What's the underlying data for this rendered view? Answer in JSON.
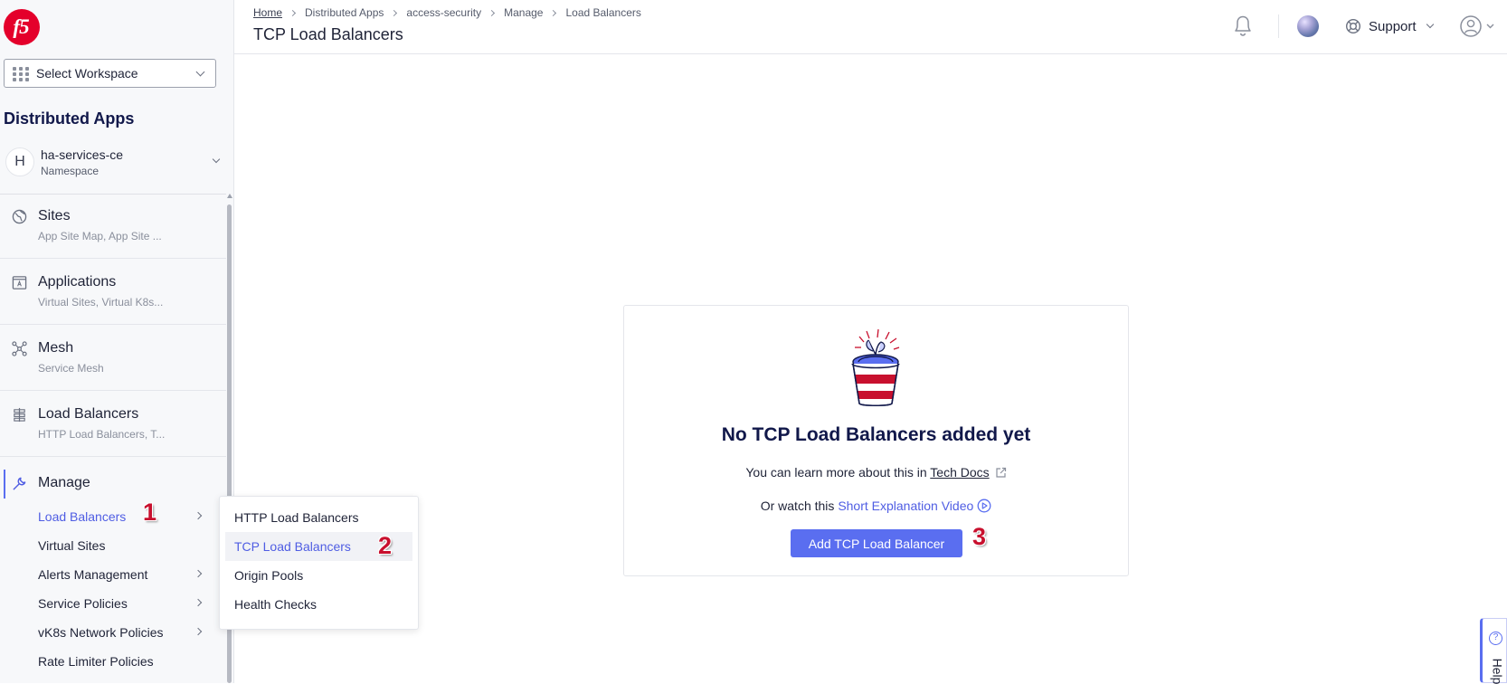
{
  "brand": {
    "logo_text": "f5",
    "accent": "#5a6ef0",
    "logo_color": "#e4002b"
  },
  "sidebar": {
    "workspace_label": "Select Workspace",
    "app_title": "Distributed Apps",
    "namespace": {
      "avatar": "H",
      "name": "ha-services-ce",
      "label": "Namespace"
    },
    "items": [
      {
        "icon": "globe-icon",
        "title": "Sites",
        "subtitle": "App Site Map, App Site ..."
      },
      {
        "icon": "app-window-icon",
        "title": "Applications",
        "subtitle": "Virtual Sites, Virtual K8s..."
      },
      {
        "icon": "mesh-icon",
        "title": "Mesh",
        "subtitle": "Service Mesh"
      },
      {
        "icon": "load-balancer-icon",
        "title": "Load Balancers",
        "subtitle": "HTTP Load Balancers, T..."
      }
    ],
    "manage": {
      "title": "Manage",
      "items": [
        {
          "label": "Load Balancers",
          "has_submenu": true,
          "active": true
        },
        {
          "label": "Virtual Sites",
          "has_submenu": false
        },
        {
          "label": "Alerts Management",
          "has_submenu": true
        },
        {
          "label": "Service Policies",
          "has_submenu": true
        },
        {
          "label": "vK8s Network Policies",
          "has_submenu": true
        },
        {
          "label": "Rate Limiter Policies",
          "has_submenu": false
        }
      ]
    }
  },
  "flyout": {
    "items": [
      {
        "label": "HTTP Load Balancers"
      },
      {
        "label": "TCP Load Balancers",
        "selected": true
      },
      {
        "label": "Origin Pools"
      },
      {
        "label": "Health Checks"
      }
    ]
  },
  "header": {
    "breadcrumb": [
      "Home",
      "Distributed Apps",
      "access-security",
      "Manage",
      "Load Balancers"
    ],
    "page_title": "TCP Load Balancers",
    "support_label": "Support"
  },
  "empty_state": {
    "title": "No TCP Load Balancers added yet",
    "learn_prefix": "You can learn more about this in",
    "learn_link": "Tech Docs",
    "watch_prefix": "Or watch this",
    "watch_link": "Short Explanation Video",
    "add_button": "Add TCP Load Balancer"
  },
  "steps": [
    "1",
    "2",
    "3"
  ],
  "help_tab": {
    "label": "Help",
    "icon": "question-icon"
  }
}
